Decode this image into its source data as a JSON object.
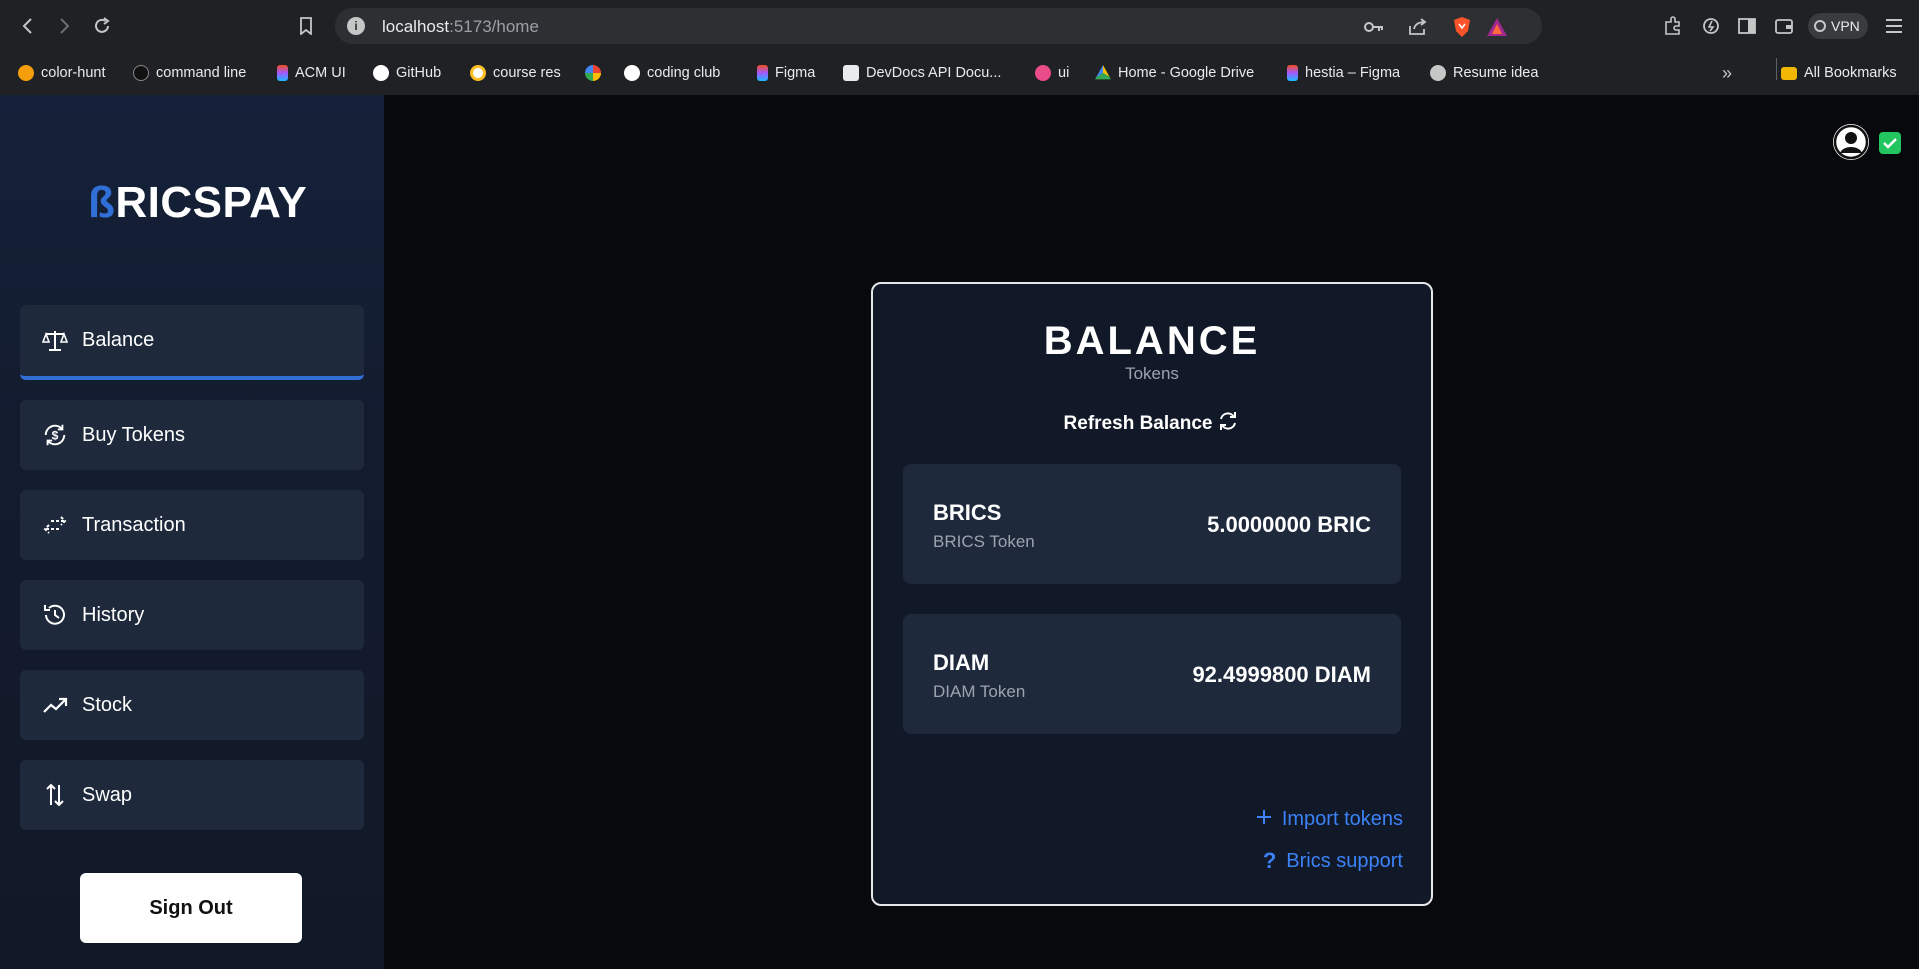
{
  "browser": {
    "url_host": "localhost",
    "url_rest": ":5173/home",
    "vpn_label": "VPN",
    "bookmarks": [
      {
        "label": "color-hunt",
        "icon": "color-hunt-icon",
        "color": "#f59e0b"
      },
      {
        "label": "command line",
        "icon": "command-line-icon",
        "color": "#111111"
      },
      {
        "label": "ACM UI",
        "icon": "figma-icon",
        "color": "#f24e1e"
      },
      {
        "label": "GitHub",
        "icon": "github-icon",
        "color": "#ffffff"
      },
      {
        "label": "course res",
        "icon": "course-res-icon",
        "color": "#fbbf24"
      },
      {
        "label": "",
        "icon": "google-photos-icon",
        "color": "#ea4335"
      },
      {
        "label": "coding club",
        "icon": "github-icon",
        "color": "#ffffff"
      },
      {
        "label": "Figma",
        "icon": "figma-icon",
        "color": "#f24e1e"
      },
      {
        "label": "DevDocs API Docu...",
        "icon": "devdocs-icon",
        "color": "#9aa0a6"
      },
      {
        "label": "ui",
        "icon": "dribbble-icon",
        "color": "#ea4c89"
      },
      {
        "label": "Home - Google Drive",
        "icon": "google-drive-icon",
        "color": "#34a853"
      },
      {
        "label": "hestia – Figma",
        "icon": "figma-icon",
        "color": "#f24e1e"
      },
      {
        "label": "Resume idea",
        "icon": "globe-icon",
        "color": "#c4c7c5"
      }
    ],
    "all_bookmarks": "All Bookmarks"
  },
  "app": {
    "logo_b": "ß",
    "logo_rest": "RICSPAY",
    "nav": [
      {
        "label": "Balance",
        "icon": "balance-scale-icon",
        "active": true
      },
      {
        "label": "Buy Tokens",
        "icon": "dollar-cycle-icon",
        "active": false
      },
      {
        "label": "Transaction",
        "icon": "transfer-arrows-icon",
        "active": false
      },
      {
        "label": "History",
        "icon": "history-clock-icon",
        "active": false
      },
      {
        "label": "Stock",
        "icon": "trending-up-icon",
        "active": false
      },
      {
        "label": "Swap",
        "icon": "swap-vertical-icon",
        "active": false
      }
    ],
    "sign_out": "Sign Out",
    "accent": "#2f6fd6"
  },
  "card": {
    "title": "BALANCE",
    "subtitle": "Tokens",
    "refresh_label": "Refresh Balance",
    "tokens": [
      {
        "symbol": "BRICS",
        "name": "BRICS Token",
        "amount": "5.0000000 BRIC"
      },
      {
        "symbol": "DIAM",
        "name": "DIAM Token",
        "amount": "92.4999800 DIAM"
      }
    ],
    "import_label": "Import tokens",
    "support_label": "Brics support",
    "link_color": "#3b82f6"
  }
}
